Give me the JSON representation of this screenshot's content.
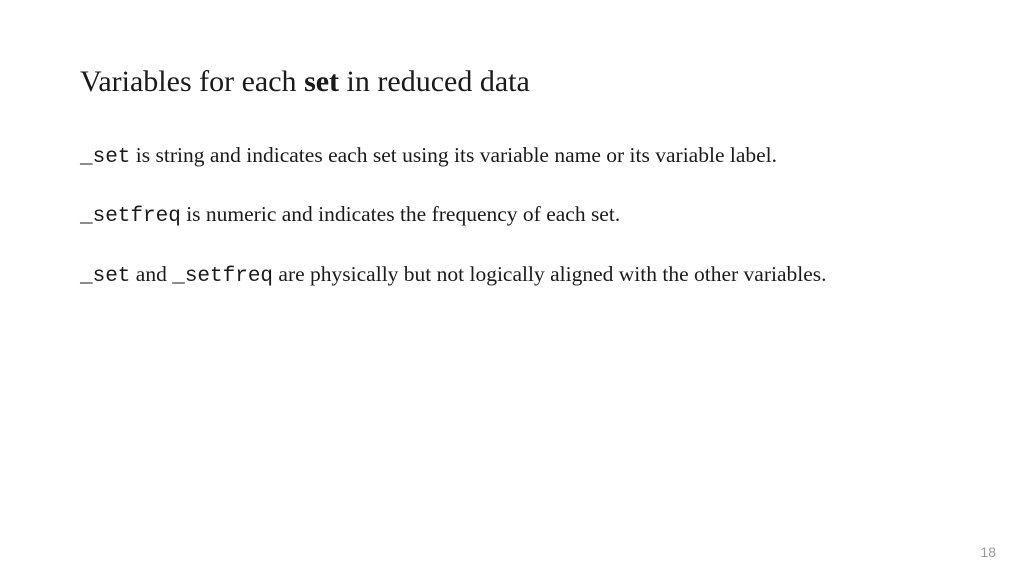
{
  "title": {
    "part1": "Variables for each ",
    "bold": "set",
    "part2": " in reduced data"
  },
  "para1": {
    "code1": "_set",
    "text1": "  is string and indicates each set using its variable name or its variable label."
  },
  "para2": {
    "code1": "_setfreq",
    "text1": "  is numeric and indicates the frequency of each set."
  },
  "para3": {
    "code1": "_set",
    "text1": "  and ",
    "code2": "_setfreq",
    "text2": " are physically but not logically aligned with the other variables."
  },
  "pageNumber": "18"
}
